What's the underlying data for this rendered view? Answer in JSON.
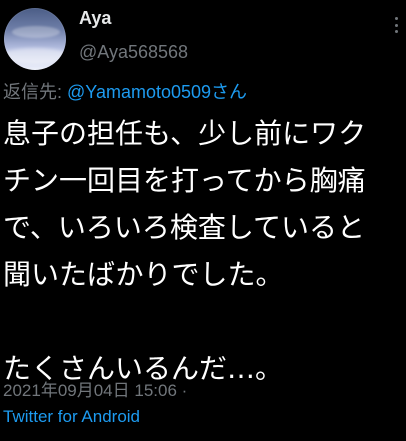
{
  "author": {
    "name": "Aya",
    "handle": "@Aya568568"
  },
  "reply": {
    "prefix": "返信先:",
    "to": "@Yamamoto0509さん"
  },
  "tweet": {
    "lines": [
      "息子の担任も、少し前にワク",
      "チン一回目を打ってから胸痛",
      "で、いろいろ検査していると",
      "聞いたばかりでした。",
      "",
      "たくさんいるんだ…。"
    ]
  },
  "meta": {
    "timestamp": "2021年09月04日 15:06 ·",
    "source": "Twitter for Android"
  },
  "icons": {
    "menu": "more-vertical-icon"
  },
  "colors": {
    "background": "#000000",
    "link": "#1d9bf0",
    "muted": "#71767b",
    "text": "#ffffff"
  }
}
